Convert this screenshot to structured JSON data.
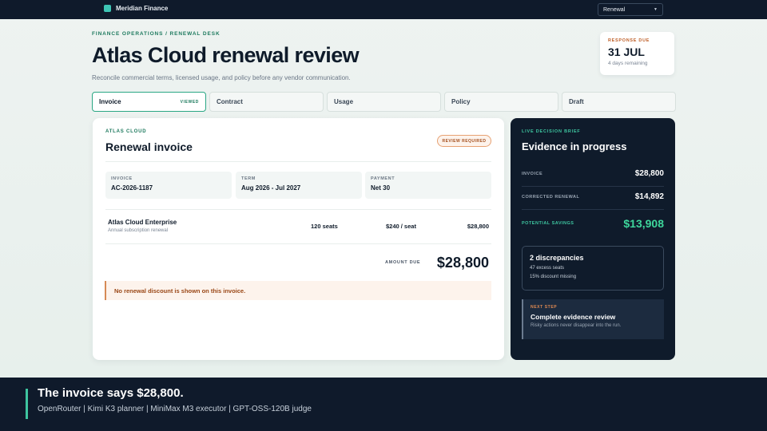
{
  "topbar": {
    "brand": "Meridian Finance",
    "select_value": "Renewal"
  },
  "header": {
    "eyebrow": "FINANCE OPERATIONS / RENEWAL DESK",
    "title": "Atlas Cloud renewal review",
    "subtitle": "Reconcile commercial terms, licensed usage, and policy before any vendor communication."
  },
  "due": {
    "label": "RESPONSE DUE",
    "date": "31 JUL",
    "remaining": "4 days remaining"
  },
  "tabs": [
    {
      "label": "Invoice",
      "badge": "VIEWED"
    },
    {
      "label": "Contract",
      "badge": ""
    },
    {
      "label": "Usage",
      "badge": ""
    },
    {
      "label": "Policy",
      "badge": ""
    },
    {
      "label": "Draft",
      "badge": ""
    }
  ],
  "invoice": {
    "eyebrow": "ATLAS CLOUD",
    "title": "Renewal invoice",
    "badge": "REVIEW REQUIRED",
    "meta": [
      {
        "label": "INVOICE",
        "value": "AC-2026-1187"
      },
      {
        "label": "TERM",
        "value": "Aug 2026 - Jul 2027"
      },
      {
        "label": "PAYMENT",
        "value": "Net 30"
      }
    ],
    "line": {
      "name": "Atlas Cloud Enterprise",
      "description": "Annual subscription renewal",
      "seats": "120 seats",
      "rate": "$240 / seat",
      "total": "$28,800"
    },
    "amount_label": "AMOUNT DUE",
    "amount_value": "$28,800",
    "alert": "No renewal discount is shown on this invoice."
  },
  "brief": {
    "eyebrow": "LIVE DECISION BRIEF",
    "title": "Evidence in progress",
    "rows": [
      {
        "label": "INVOICE",
        "value": "$28,800"
      },
      {
        "label": "CORRECTED RENEWAL",
        "value": "$14,892"
      },
      {
        "label": "POTENTIAL SAVINGS",
        "value": "$13,908"
      }
    ],
    "discrepancies": {
      "title": "2 discrepancies",
      "items": [
        "47 excess seats",
        "15% discount missing"
      ]
    },
    "next": {
      "label": "NEXT STEP",
      "title": "Complete evidence review",
      "description": "Risky actions never disappear into the run."
    }
  },
  "caption": {
    "title": "The invoice says $28,800.",
    "subtitle": "OpenRouter | Kimi K3 planner | MiniMax M3 executor | GPT-OSS-120B judge"
  },
  "colors": {
    "accent": "#2aa784",
    "navy": "#0f1b2b",
    "warning": "#d68a55",
    "savings": "#3ed79c"
  }
}
